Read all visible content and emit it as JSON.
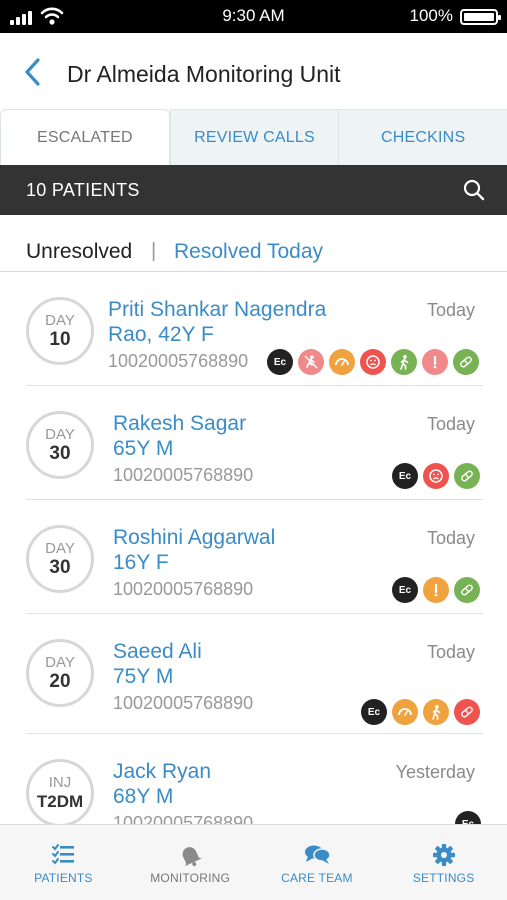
{
  "status_bar": {
    "time": "9:30 AM",
    "battery": "100%"
  },
  "header": {
    "title": "Dr Almeida Monitoring Unit"
  },
  "tabs": [
    {
      "label": "ESCALATED",
      "active": true
    },
    {
      "label": "REVIEW CALLS",
      "active": false
    },
    {
      "label": "CHECKINS",
      "active": false
    }
  ],
  "patients_bar": {
    "count_label": "10 PATIENTS"
  },
  "filter": {
    "unresolved": "Unresolved",
    "separator": "|",
    "resolved": "Resolved Today"
  },
  "patients": [
    {
      "day_label": "DAY",
      "day_value": "10",
      "name_line1": "Priti Shankar Nagendra",
      "name_line2": "Rao, 42Y F",
      "id": "10020005768890",
      "date": "Today",
      "badges": [
        {
          "icon": "ec-badge",
          "text": "Ec",
          "color": "#222222"
        },
        {
          "icon": "no-exercise-icon",
          "color": "#f08a8a"
        },
        {
          "icon": "gauge-icon",
          "color": "#f0a23f"
        },
        {
          "icon": "sad-face-icon",
          "color": "#ef5350"
        },
        {
          "icon": "walking-icon",
          "color": "#77b255"
        },
        {
          "icon": "exclamation-icon",
          "color": "#f08a8a"
        },
        {
          "icon": "pill-icon",
          "color": "#77b255"
        }
      ]
    },
    {
      "day_label": "DAY",
      "day_value": "30",
      "name_line1": "Rakesh Sagar",
      "name_line2": "65Y M",
      "id": "10020005768890",
      "date": "Today",
      "badges": [
        {
          "icon": "ec-badge",
          "text": "Ec",
          "color": "#222222"
        },
        {
          "icon": "sad-face-icon",
          "color": "#ef5350"
        },
        {
          "icon": "pill-icon",
          "color": "#77b255"
        }
      ]
    },
    {
      "day_label": "DAY",
      "day_value": "30",
      "name_line1": "Roshini Aggarwal",
      "name_line2": "16Y F",
      "id": "10020005768890",
      "date": "Today",
      "badges": [
        {
          "icon": "ec-badge",
          "text": "Ec",
          "color": "#222222"
        },
        {
          "icon": "exclamation-icon",
          "color": "#f0a23f"
        },
        {
          "icon": "pill-icon",
          "color": "#77b255"
        }
      ]
    },
    {
      "day_label": "DAY",
      "day_value": "20",
      "name_line1": "Saeed Ali",
      "name_line2": "75Y M",
      "id": "10020005768890",
      "date": "Today",
      "badges": [
        {
          "icon": "ec-badge",
          "text": "Ec",
          "color": "#222222"
        },
        {
          "icon": "gauge-icon",
          "color": "#f0a23f"
        },
        {
          "icon": "walking-icon",
          "color": "#f0a23f"
        },
        {
          "icon": "pill-icon",
          "color": "#ef5350"
        }
      ]
    },
    {
      "day_label": "INJ",
      "day_value": "T2DM",
      "name_line1": "Jack Ryan",
      "name_line2": "68Y M",
      "id": "10020005768890",
      "date": "Yesterday",
      "badges": [
        {
          "icon": "ec-badge",
          "text": "Ec",
          "color": "#222222"
        }
      ]
    }
  ],
  "bottom_nav": [
    {
      "label": "PATIENTS",
      "icon": "checklist-icon",
      "active": true
    },
    {
      "label": "MONITORING",
      "icon": "bell-icon",
      "active": false
    },
    {
      "label": "CARE TEAM",
      "icon": "chat-bubbles-icon",
      "active": false
    },
    {
      "label": "SETTINGS",
      "icon": "gear-icon",
      "active": false
    }
  ],
  "colors": {
    "accent": "#3a8cc7",
    "dark_bar": "#333333",
    "tab_bg": "#eef3f6"
  }
}
